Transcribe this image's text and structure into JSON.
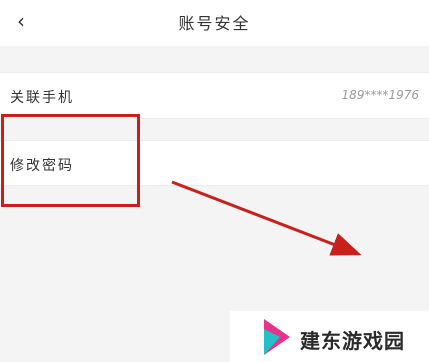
{
  "header": {
    "back_icon": "chevron-left-icon",
    "back_glyph": "‹",
    "title": "账号安全"
  },
  "rows": [
    {
      "label": "关联手机",
      "value": "189****1976"
    },
    {
      "label": "修改密码"
    }
  ],
  "annotation": {
    "color": "#c8201b"
  },
  "watermark": {
    "text": "建东游戏园",
    "logo_colors": [
      "#e8328c",
      "#23c0c8"
    ]
  }
}
